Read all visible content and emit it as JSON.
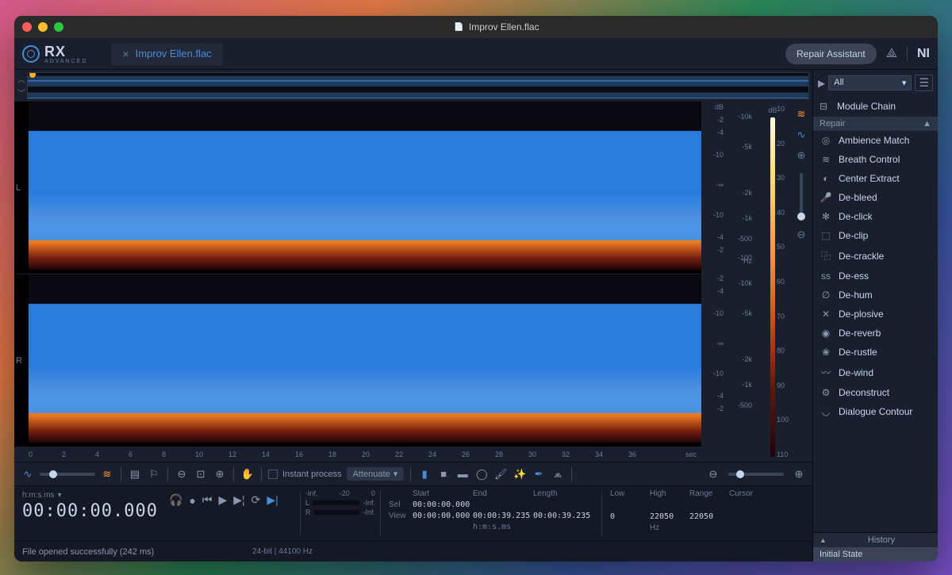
{
  "window": {
    "title": "Improv Ellen.flac"
  },
  "app": {
    "name": "RX",
    "edition": "ADVANCED"
  },
  "tab": {
    "name": "Improv Ellen.flac"
  },
  "topbar": {
    "repair_assistant": "Repair Assistant"
  },
  "db_scale": {
    "unit": "dB",
    "ticks_L": [
      "-2",
      "-4",
      "-10",
      "-∞",
      "-10",
      "-4",
      "-2"
    ],
    "ticks_R": [
      "-2",
      "-4",
      "-10",
      "-∞",
      "-10",
      "-4",
      "-2"
    ]
  },
  "hz_scale": {
    "unit": "Hz",
    "ticks": [
      "-10k",
      "-5k",
      "-2k",
      "-1k",
      "-500",
      "-100"
    ]
  },
  "color_scale": {
    "unit": "dB",
    "ticks": [
      "10",
      "20",
      "30",
      "40",
      "50",
      "60",
      "70",
      "80",
      "90",
      "100",
      "110"
    ]
  },
  "timeline": {
    "unit": "sec",
    "ticks": [
      "0",
      "2",
      "4",
      "6",
      "8",
      "10",
      "12",
      "14",
      "16",
      "18",
      "20",
      "22",
      "24",
      "26",
      "28",
      "30",
      "32",
      "34",
      "36"
    ]
  },
  "toolbar": {
    "instant_process": "Instant process",
    "mode": "Attenuate"
  },
  "transport": {
    "format": "h:m:s.ms",
    "time": "00:00:00.000",
    "meter": {
      "top_left": "-Inf.",
      "top_mid": "-20",
      "top_right": "0",
      "L": "L",
      "R": "R",
      "L_val": "-Inf.",
      "R_val": "-Inf."
    },
    "sel_view": {
      "headers": [
        "Start",
        "End",
        "Length"
      ],
      "sel_label": "Sel",
      "view_label": "View",
      "sel": [
        "00:00:00.000",
        "",
        ""
      ],
      "view": [
        "00:00:00.000",
        "00:00:39.235",
        "00:00:39.235"
      ],
      "fmt": "h:m:s.ms"
    },
    "freq": {
      "headers": [
        "Low",
        "High",
        "Range",
        "Cursor"
      ],
      "values": [
        "0",
        "22050",
        "22050",
        ""
      ],
      "unit": "Hz"
    }
  },
  "status": {
    "msg": "File opened successfully (242 ms)",
    "info": "24-bit | 44100 Hz"
  },
  "sidebar": {
    "all": "All",
    "module_chain": "Module Chain",
    "category": "Repair",
    "modules": [
      "Ambience Match",
      "Breath Control",
      "Center Extract",
      "De-bleed",
      "De-click",
      "De-clip",
      "De-crackle",
      "De-ess",
      "De-hum",
      "De-plosive",
      "De-reverb",
      "De-rustle",
      "De-wind",
      "Deconstruct",
      "Dialogue Contour"
    ],
    "icons": [
      "◎",
      "≋",
      "◐",
      "🎤",
      "✻",
      "⬚",
      "⿻",
      "ss",
      "∅",
      "✕",
      "◉",
      "❀",
      "〰",
      "⚙",
      "◡"
    ]
  },
  "history": {
    "title": "History",
    "items": [
      "Initial State"
    ]
  }
}
